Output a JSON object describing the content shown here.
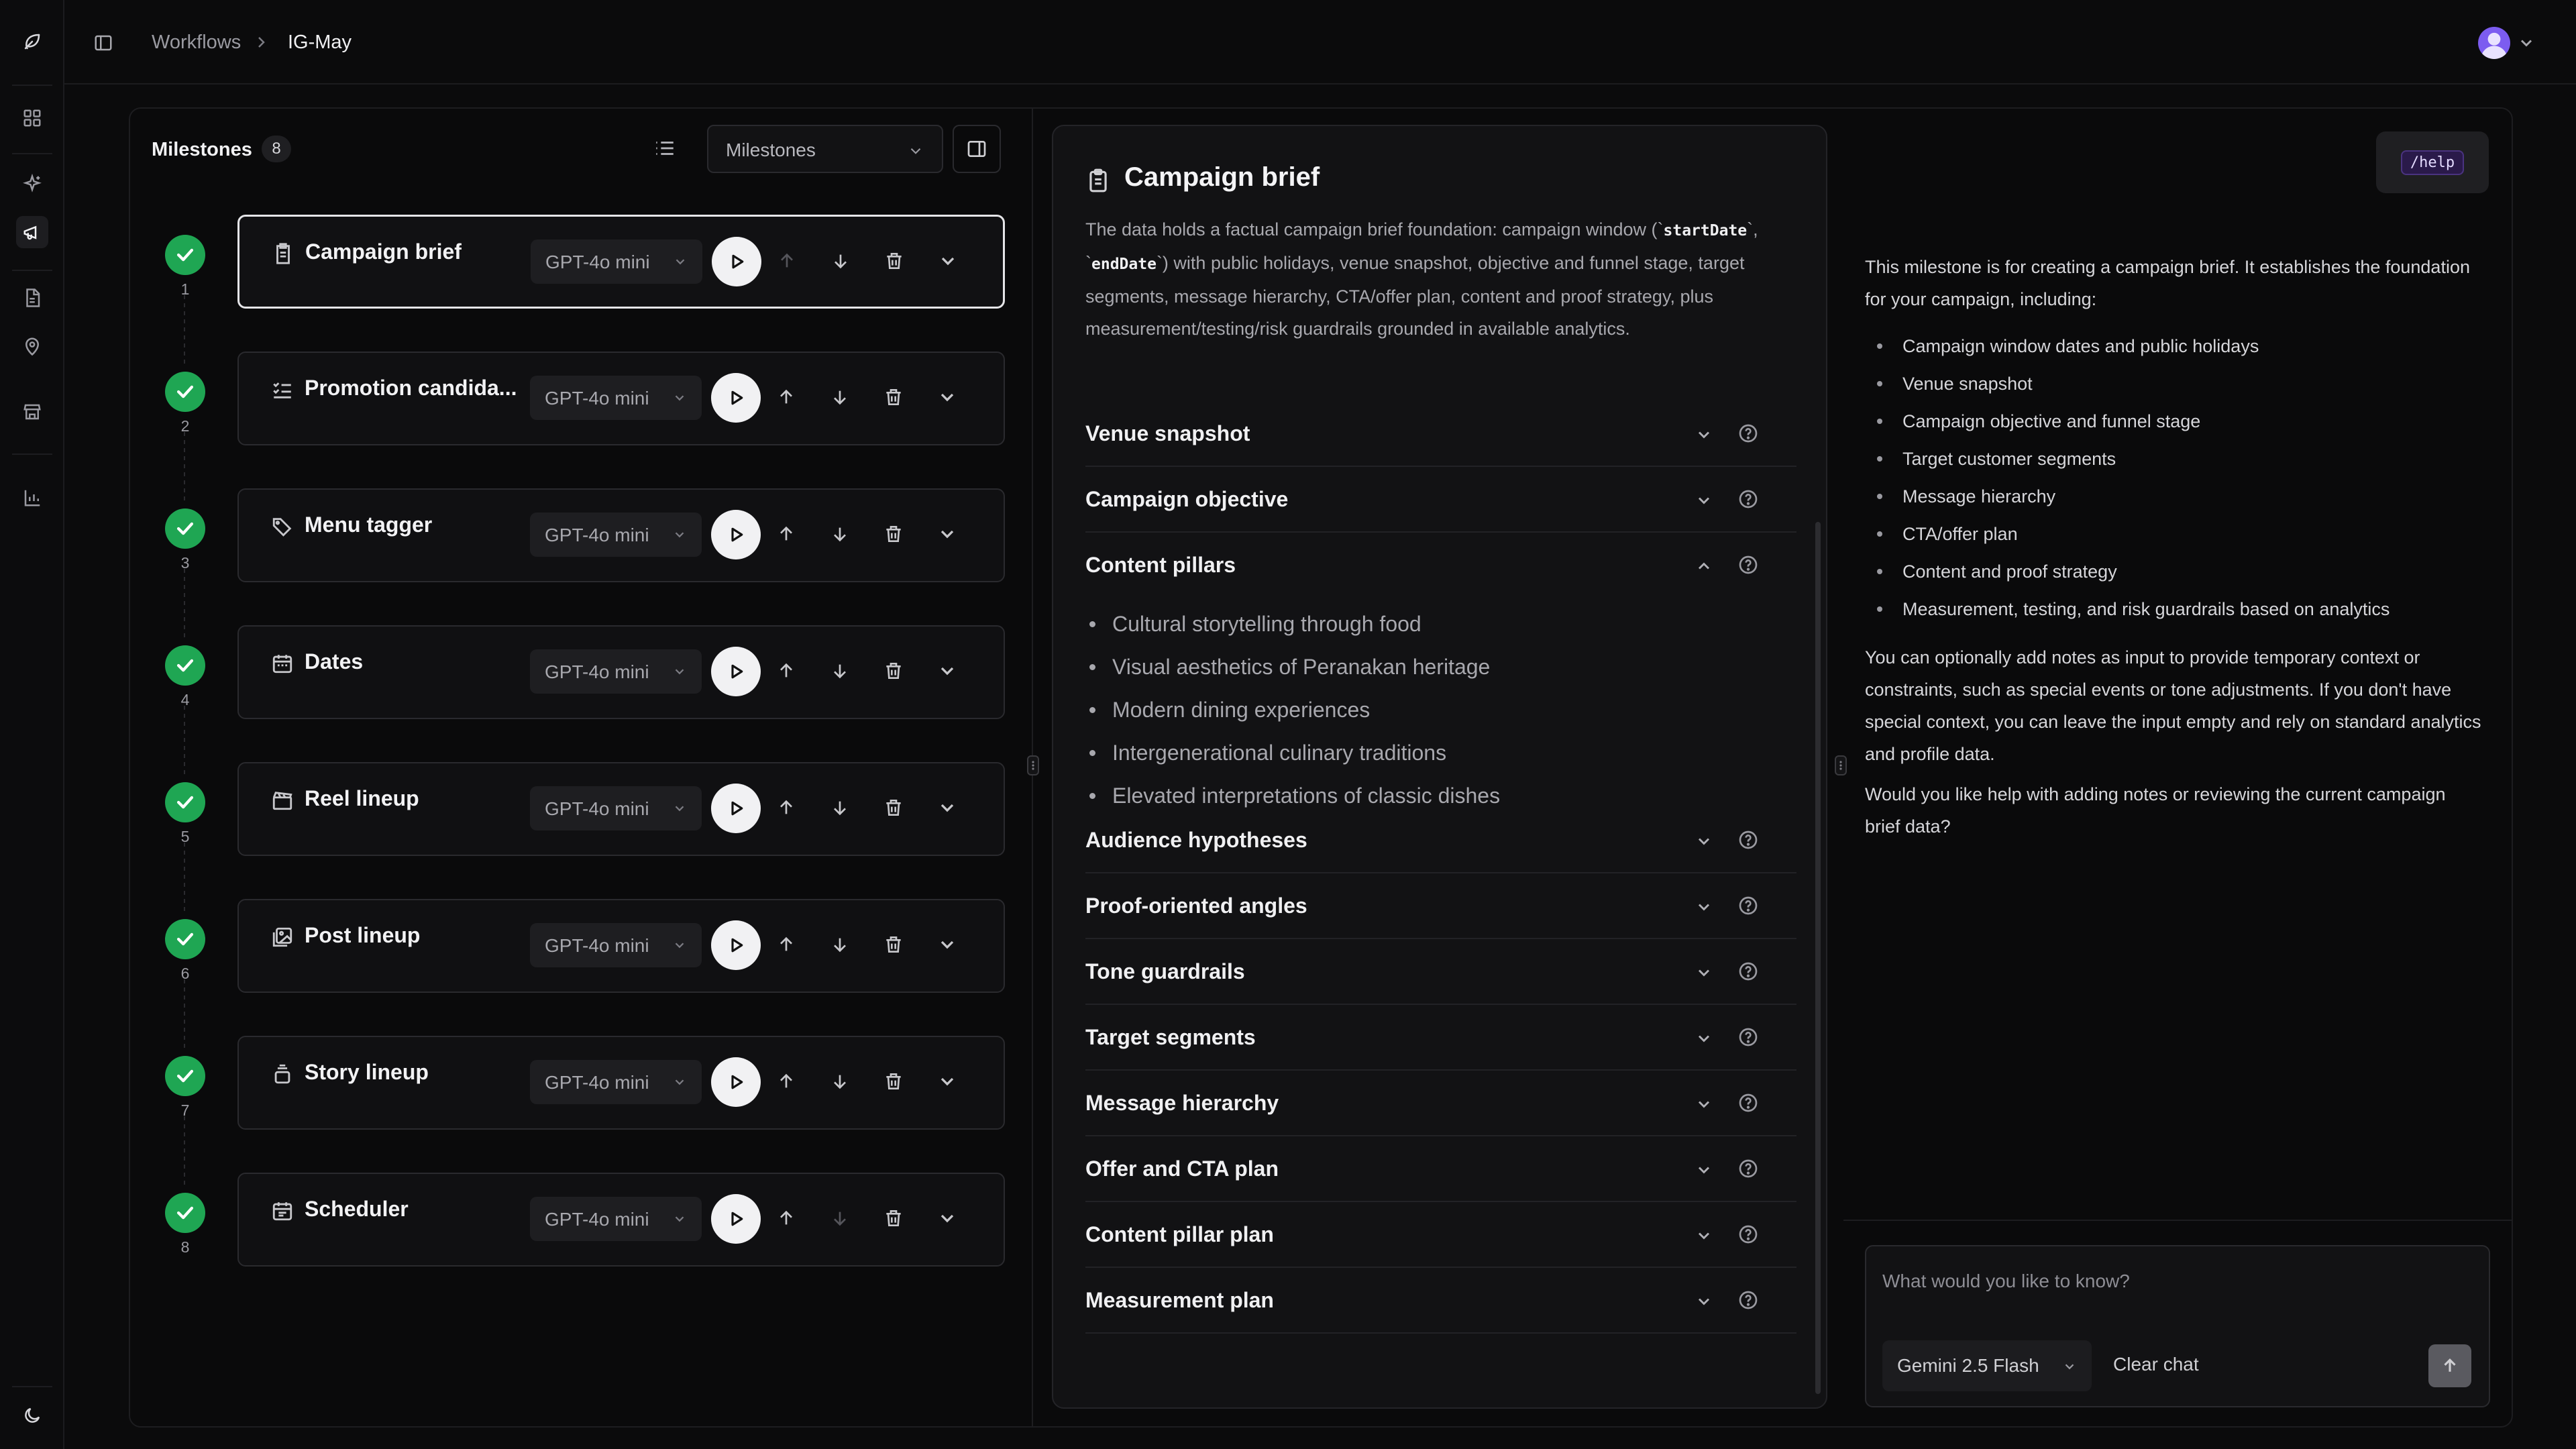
{
  "header": {
    "breadcrumb_root": "Workflows",
    "breadcrumb_current": "IG-May"
  },
  "rail": {
    "icons": [
      "leaf-logo",
      "dashboard",
      "sparkle",
      "megaphone",
      "document",
      "map-pin",
      "store",
      "bar-chart",
      "moon"
    ]
  },
  "milestones": {
    "title": "Milestones",
    "count": "8",
    "view_select": "Milestones",
    "items": [
      {
        "number": "1",
        "name": "Campaign brief",
        "model": "GPT-4o mini",
        "icon": "clipboard-icon",
        "status": "done"
      },
      {
        "number": "2",
        "name": "Promotion candida...",
        "model": "GPT-4o mini",
        "icon": "list-check-icon",
        "status": "done"
      },
      {
        "number": "3",
        "name": "Menu tagger",
        "model": "GPT-4o mini",
        "icon": "tags-icon",
        "status": "done"
      },
      {
        "number": "4",
        "name": "Dates",
        "model": "GPT-4o mini",
        "icon": "calendar-icon",
        "status": "done"
      },
      {
        "number": "5",
        "name": "Reel lineup",
        "model": "GPT-4o mini",
        "icon": "clapper-icon",
        "status": "done"
      },
      {
        "number": "6",
        "name": "Post lineup",
        "model": "GPT-4o mini",
        "icon": "images-icon",
        "status": "done"
      },
      {
        "number": "7",
        "name": "Story lineup",
        "model": "GPT-4o mini",
        "icon": "stack-icon",
        "status": "done"
      },
      {
        "number": "8",
        "name": "Scheduler",
        "model": "GPT-4o mini",
        "icon": "calendar-clock-icon",
        "status": "done"
      }
    ]
  },
  "brief": {
    "title": "Campaign brief",
    "desc_1": "The data holds a factual campaign brief foundation: campaign window (`",
    "code_1": "startDate",
    "desc_2": "`, `",
    "code_2": "endDate",
    "desc_3": "`) with public holidays, venue snapshot, objective and funnel stage, target segments, message hierarchy, CTA/offer plan, content and proof strategy, plus measurement/testing/risk guardrails grounded in available analytics.",
    "sections_top": [
      "Venue snapshot",
      "Campaign objective",
      "Content pillars"
    ],
    "pillars": [
      "Cultural storytelling through food",
      "Visual aesthetics of Peranakan heritage",
      "Modern dining experiences",
      "Intergenerational culinary traditions",
      "Elevated interpretations of classic dishes"
    ],
    "sections_bottom": [
      "Audience hypotheses",
      "Proof-oriented angles",
      "Tone guardrails",
      "Target segments",
      "Message hierarchy",
      "Offer and CTA plan",
      "Content pillar plan",
      "Measurement plan"
    ]
  },
  "assistant": {
    "help_chip": "/help",
    "intro": "This milestone is for creating a campaign brief. It establishes the foundation for your campaign, including:",
    "bullets": [
      "Campaign window dates and public holidays",
      "Venue snapshot",
      "Campaign objective and funnel stage",
      "Target customer segments",
      "Message hierarchy",
      "CTA/offer plan",
      "Content and proof strategy",
      "Measurement, testing, and risk guardrails based on analytics"
    ],
    "para_2": "You can optionally add notes as input to provide temporary context or constraints, such as special events or tone adjustments. If you don't have special context, you can leave the input empty and rely on standard analytics and profile data.",
    "para_3": "Would you like help with adding notes or reviewing the current campaign brief data?",
    "input_placeholder": "What would you like to know?",
    "model": "Gemini 2.5 Flash",
    "clear_label": "Clear chat"
  }
}
